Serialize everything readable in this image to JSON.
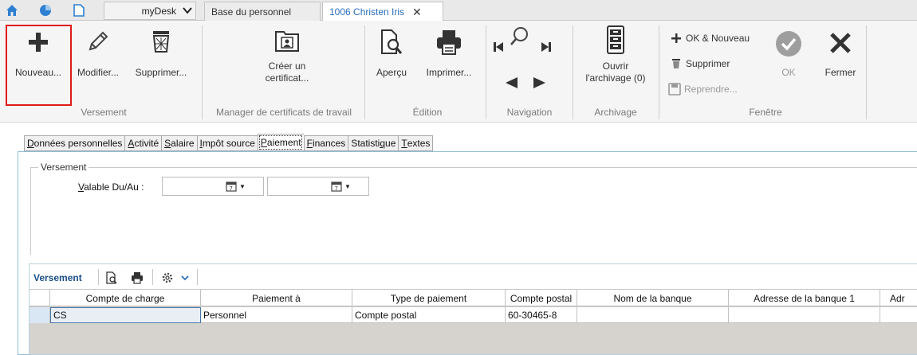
{
  "titlebar": {
    "mydesk_label": "myDesk",
    "tabs": [
      {
        "label": "Base du personnel"
      },
      {
        "label": "1006 Christen Iris"
      }
    ],
    "close_glyph": "✕"
  },
  "ribbon": {
    "groups": {
      "versement": {
        "label": "Versement",
        "buttons": {
          "nouveau": "Nouveau...",
          "modifier": "Modifier...",
          "supprimer": "Supprimer..."
        }
      },
      "manager": {
        "label": "Manager de certificats de travail",
        "buttons": {
          "creer_line1": "Créer un",
          "creer_line2": "certificat..."
        }
      },
      "edition": {
        "label": "Édition",
        "buttons": {
          "apercu": "Aperçu",
          "imprimer": "Imprimer..."
        }
      },
      "navigation": {
        "label": "Navigation"
      },
      "archivage": {
        "label": "Archivage",
        "buttons": {
          "ouvrir_line1": "Ouvrir",
          "ouvrir_line2": "l'archivage  (0)"
        }
      },
      "fenetre": {
        "label": "Fenêtre",
        "buttons": {
          "ok_nouveau": "OK & Nouveau",
          "supprimer": "Supprimer",
          "reprendre": "Reprendre...",
          "ok": "OK",
          "fermer": "Fermer"
        }
      }
    }
  },
  "page_tabs": [
    {
      "prefix": "",
      "underlined": "D",
      "rest": "onnées personnelles"
    },
    {
      "prefix": "",
      "underlined": "A",
      "rest": "ctivité"
    },
    {
      "prefix": "",
      "underlined": "S",
      "rest": "alaire"
    },
    {
      "prefix": "",
      "underlined": "I",
      "rest": "mpôt source"
    },
    {
      "prefix": "",
      "underlined": "P",
      "rest": "aiement"
    },
    {
      "prefix": "",
      "underlined": "F",
      "rest": "inances"
    },
    {
      "prefix": "Statisti",
      "underlined": "q",
      "rest": "ue"
    },
    {
      "prefix": "",
      "underlined": "T",
      "rest": "extes"
    }
  ],
  "form": {
    "legend": "Versement",
    "valable_underlined": "V",
    "valable_rest": "alable Du/Au :",
    "date_from": "",
    "date_to": ""
  },
  "grid": {
    "title": "Versement",
    "columns": [
      "Compte de charge",
      "Paiement à",
      "Type de paiement",
      "Compte postal",
      "Nom de la banque",
      "Adresse de la banque 1",
      "Adr"
    ],
    "rows": [
      [
        "CS",
        "Personnel",
        "Compte postal",
        "60-30465-8",
        "",
        "",
        ""
      ]
    ]
  },
  "colors": {
    "accent": "#2a6ebb",
    "highlight_border": "#e11919",
    "ok_circle": "#9e9e9e"
  }
}
